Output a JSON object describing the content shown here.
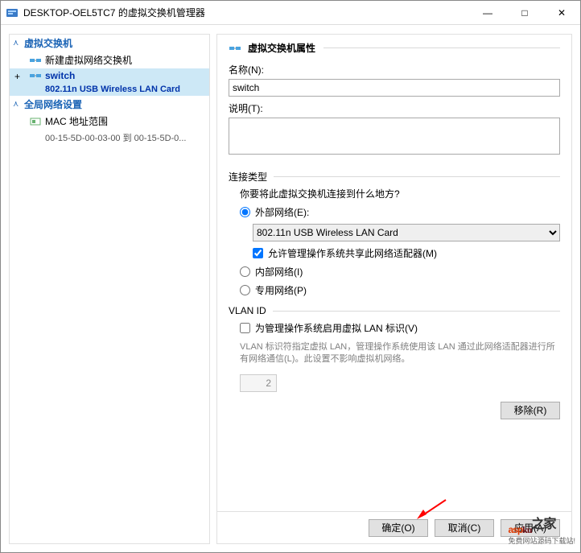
{
  "window": {
    "title": "DESKTOP-OEL5TC7 的虚拟交换机管理器",
    "min": "—",
    "max": "□",
    "close": "✕"
  },
  "tree": {
    "section1": "虚拟交换机",
    "new_switch": "新建虚拟网络交换机",
    "switch_name": "switch",
    "switch_nic": "802.11n USB Wireless LAN Card",
    "section2": "全局网络设置",
    "mac_range": "MAC 地址范围",
    "mac_detail": "00-15-5D-00-03-00 到 00-15-5D-0..."
  },
  "props": {
    "header": "虚拟交换机属性",
    "name_label": "名称(N):",
    "name_value": "switch",
    "desc_label": "说明(T):",
    "desc_value": "",
    "conn_group": "连接类型",
    "conn_question": "你要将此虚拟交换机连接到什么地方?",
    "ext_label": "外部网络(E):",
    "nic_selected": "802.11n USB Wireless LAN Card",
    "allow_mgmt": "允许管理操作系统共享此网络适配器(M)",
    "int_label": "内部网络(I)",
    "priv_label": "专用网络(P)",
    "vlan_group": "VLAN ID",
    "vlan_enable": "为管理操作系统启用虚拟 LAN 标识(V)",
    "vlan_help": "VLAN 标识符指定虚拟 LAN，管理操作系统使用该 LAN 通过此网络适配器进行所有网络通信(L)。此设置不影响虚拟机网络。",
    "vlan_value": "2",
    "remove_btn": "移除(R)"
  },
  "buttons": {
    "ok": "确定(O)",
    "cancel": "取消(C)",
    "apply": "应用(A)"
  },
  "watermark": {
    "brand1": "asp",
    "brand2": "ku",
    "tag": "之家",
    "sub": "免费网站源码下载站!"
  }
}
